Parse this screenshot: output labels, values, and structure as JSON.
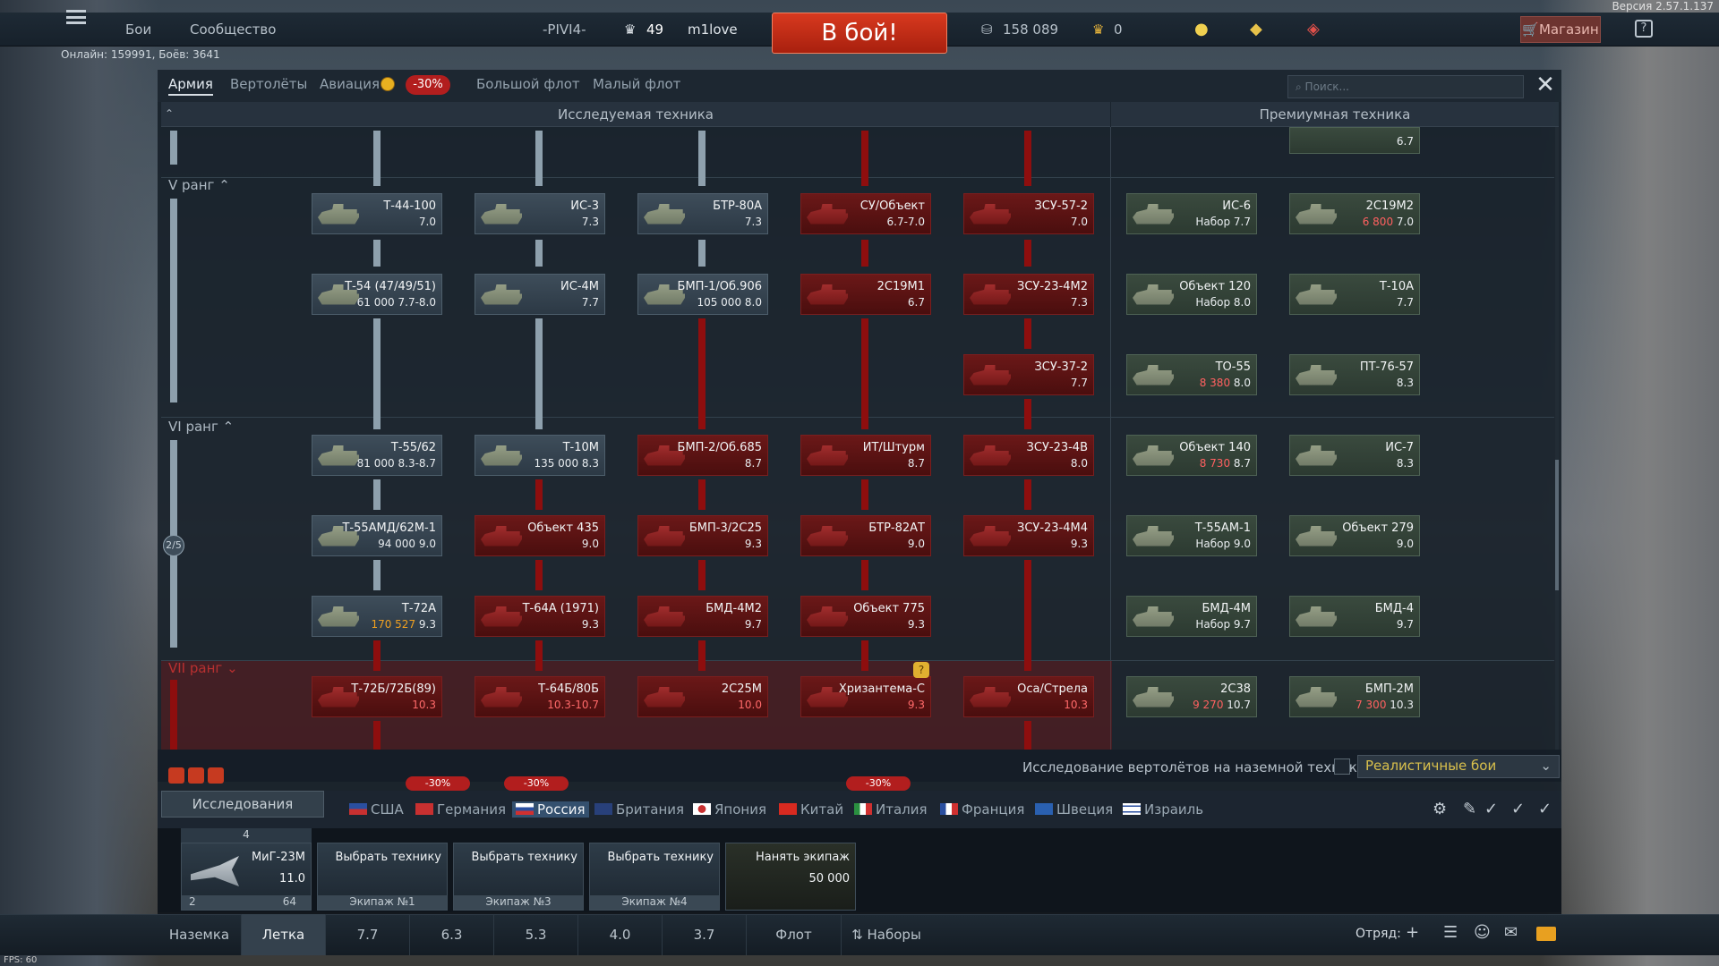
{
  "version": "Версия 2.57.1.137",
  "topbar": {
    "battles": "Бои",
    "community": "Сообщество",
    "squad_tag": "-PIVI4-",
    "level": "49",
    "username": "m1love",
    "battle_button": "В бой!",
    "silver_lions": "158 089",
    "golden_eagles": "0",
    "shop": "Магазин",
    "help": "?"
  },
  "online": "Онлайн: 159991, Боёв: 3641",
  "tabs": [
    "Армия",
    "Вертолёты",
    "Авиация",
    "Большой флот",
    "Малый флот"
  ],
  "aviation_discount": "-30%",
  "search_placeholder": "Поиск...",
  "headers": {
    "researchable": "Исследуемая техника",
    "premium": "Премиумная техника"
  },
  "ranks": {
    "r5": "V ранг",
    "r6": "VI ранг",
    "r7": "VII ранг",
    "progress": "2/5"
  },
  "vehicles": {
    "top_prem": {
      "name": "",
      "br": "6.7"
    },
    "r1": [
      {
        "name": "Т-44-100",
        "br": "7.0"
      },
      {
        "name": "ИС-3",
        "br": "7.3"
      },
      {
        "name": "БТР-80А",
        "br": "7.3"
      },
      {
        "name": "СУ/Объект",
        "br": "6.7-7.0"
      },
      {
        "name": "ЗСУ-57-2",
        "br": "7.0"
      },
      {
        "name": "ИС-6",
        "br": "Набор 7.7"
      },
      {
        "name": "2С19М2",
        "cost": "6 800",
        "br": "7.0"
      }
    ],
    "r2": [
      {
        "name": "Т-54 (47/49/51)",
        "cost": "61 000",
        "br": "7.7-8.0"
      },
      {
        "name": "ИС-4М",
        "br": "7.7"
      },
      {
        "name": "БМП-1/Об.906",
        "cost": "105 000",
        "br": "8.0"
      },
      {
        "name": "2С19М1",
        "br": "6.7"
      },
      {
        "name": "ЗСУ-23-4М2",
        "br": "7.3"
      },
      {
        "name": "Объект 120",
        "br": "Набор 8.0"
      },
      {
        "name": "Т-10А",
        "br": "7.7"
      }
    ],
    "r3": [
      {
        "name": "ЗСУ-37-2",
        "br": "7.7"
      },
      {
        "name": "ТО-55",
        "cost": "8 380",
        "br": "8.0"
      },
      {
        "name": "ПТ-76-57",
        "br": "8.3"
      }
    ],
    "r4": [
      {
        "name": "Т-55/62",
        "cost": "81 000",
        "br": "8.3-8.7"
      },
      {
        "name": "Т-10М",
        "cost": "135 000",
        "br": "8.3"
      },
      {
        "name": "БМП-2/Об.685",
        "br": "8.7"
      },
      {
        "name": "ИТ/Штурм",
        "br": "8.7"
      },
      {
        "name": "ЗСУ-23-4В",
        "br": "8.0"
      },
      {
        "name": "Объект 140",
        "cost": "8 730",
        "br": "8.7"
      },
      {
        "name": "ИС-7",
        "br": "8.3"
      }
    ],
    "r5": [
      {
        "name": "Т-55АМД/62М-1",
        "cost": "94 000",
        "br": "9.0"
      },
      {
        "name": "Объект 435",
        "br": "9.0"
      },
      {
        "name": "БМП-3/2С25",
        "br": "9.3"
      },
      {
        "name": "БТР-82АТ",
        "br": "9.0"
      },
      {
        "name": "ЗСУ-23-4М4",
        "br": "9.3"
      },
      {
        "name": "Т-55АМ-1",
        "br": "Набор 9.0"
      },
      {
        "name": "Объект 279",
        "br": "9.0"
      }
    ],
    "r6": [
      {
        "name": "Т-72А",
        "cost": "170 527",
        "br": "9.3"
      },
      {
        "name": "Т-64А (1971)",
        "br": "9.3"
      },
      {
        "name": "БМД-4М2",
        "br": "9.7"
      },
      {
        "name": "Объект 775",
        "br": "9.3"
      },
      {
        "name": "БМД-4М",
        "br": "Набор 9.7"
      },
      {
        "name": "БМД-4",
        "br": "9.7"
      }
    ],
    "r7": [
      {
        "name": "Т-72Б/72Б(89)",
        "br": "10.3"
      },
      {
        "name": "Т-64Б/80Б",
        "br": "10.3-10.7"
      },
      {
        "name": "2С25М",
        "br": "10.0"
      },
      {
        "name": "Хризантема-С",
        "br": "9.3"
      },
      {
        "name": "Оса/Стрела",
        "br": "10.3"
      },
      {
        "name": "2С38",
        "cost": "9 270",
        "br": "10.7"
      },
      {
        "name": "БМП-2М",
        "cost": "7 300",
        "br": "10.3"
      }
    ]
  },
  "lower": {
    "heli_research": "Исследование вертолётов на наземной технике",
    "mode": "Реалистичные бои",
    "research_btn": "Исследования",
    "discounts": [
      "-30%",
      "-30%",
      "-30%"
    ]
  },
  "countries": [
    "США",
    "Германия",
    "Россия",
    "Британия",
    "Япония",
    "Китай",
    "Италия",
    "Франция",
    "Швеция",
    "Израиль"
  ],
  "crew": {
    "slot1": {
      "name": "МиГ-23М",
      "br": "11.0",
      "top": "4",
      "left": "2",
      "right": "64"
    },
    "choose": "Выбрать технику",
    "crews": [
      "Экипаж №1",
      "Экипаж №3",
      "Экипаж №4"
    ],
    "hire": "Нанять экипаж",
    "hire_cost": "50 000"
  },
  "bottom": {
    "tabs": [
      "Наземка",
      "Летка",
      "7.7",
      "6.3",
      "5.3",
      "4.0",
      "3.7",
      "Флот"
    ],
    "presets": "Наборы",
    "squad": "Отряд:"
  },
  "fps": "FPS: 60"
}
